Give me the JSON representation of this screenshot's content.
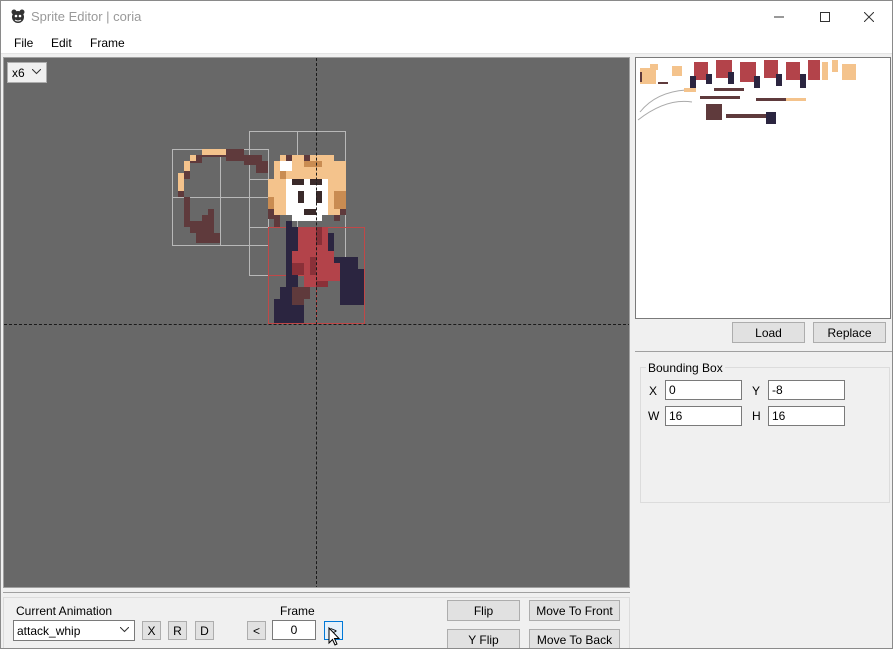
{
  "window": {
    "title": "Sprite Editor | coria",
    "controls": {
      "minimize": "minimize-icon",
      "maximize": "maximize-icon",
      "close": "close-icon"
    }
  },
  "menu": [
    "File",
    "Edit",
    "Frame"
  ],
  "canvas": {
    "zoom": "x6",
    "background": "#686868",
    "palette": {
      "outline": "#2b2540",
      "red": "#b3434a",
      "darkred": "#8a3038",
      "brown": "#5f3a3c",
      "skin": "#f4c38c",
      "skin_dark": "#c98c52",
      "white": "#ffffff",
      "eye": "#3a2a2a"
    }
  },
  "spritesheet": {
    "load_label": "Load",
    "replace_label": "Replace"
  },
  "bounding_box": {
    "legend": "Bounding Box",
    "x_label": "X",
    "x_value": "0",
    "y_label": "Y",
    "y_value": "-8",
    "w_label": "W",
    "w_value": "16",
    "h_label": "H",
    "h_value": "16"
  },
  "animation": {
    "label": "Current Animation",
    "selected": "attack_whip",
    "x_btn": "X",
    "r_btn": "R",
    "d_btn": "D"
  },
  "frame": {
    "label": "Frame",
    "prev": "<",
    "value": "0",
    "next": ">"
  },
  "actions": {
    "flip": "Flip",
    "y_flip": "Y Flip",
    "move_front": "Move To Front",
    "move_back": "Move To Back"
  }
}
